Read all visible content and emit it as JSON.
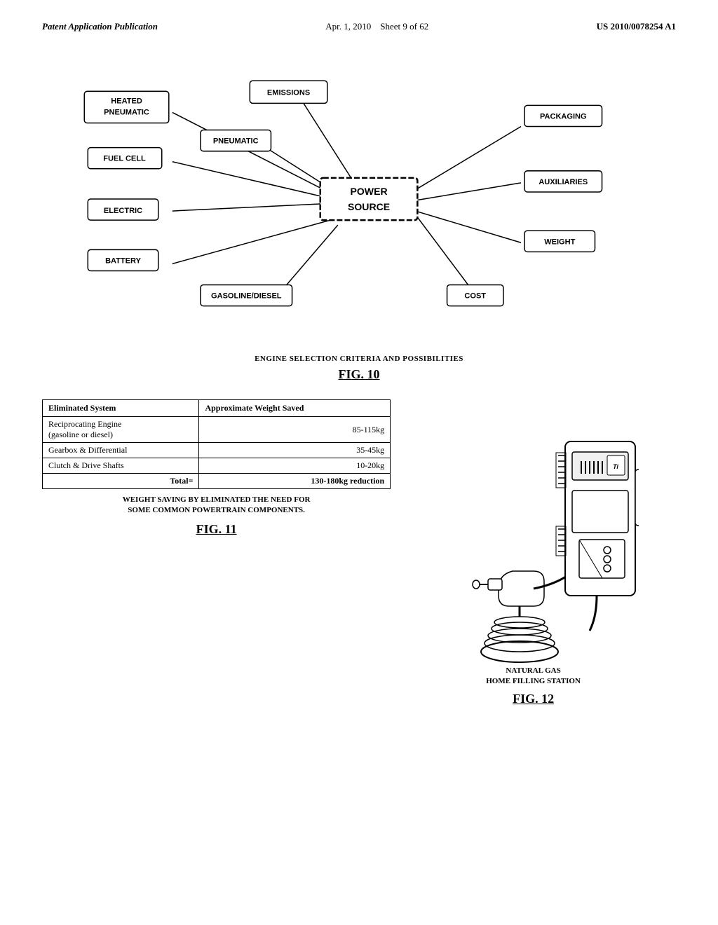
{
  "header": {
    "title": "Patent Application Publication",
    "date": "Apr. 1, 2010",
    "sheet": "Sheet 9 of 62",
    "patent": "US 2010/0078254 A1"
  },
  "fig10": {
    "caption": "ENGINE SELECTION CRITERIA AND POSSIBILITIES",
    "label": "FIG.   10",
    "nodes": {
      "heated_pneumatic": "HEATED\nPNEUMATIC",
      "emissions": "EMISSIONS",
      "pneumatic": "PNEUMATIC",
      "fuel_cell": "FUEL CELL",
      "packaging": "PACKAGING",
      "electric": "ELECTRIC",
      "power_source": "POWER\nSOURCE",
      "auxiliaries": "AUXILIARIES",
      "battery": "BATTERY",
      "weight": "WEIGHT",
      "gasoline_diesel": "GASOLINE/DIESEL",
      "cost": "COST"
    }
  },
  "fig11": {
    "caption": "WEIGHT SAVING BY ELIMINATED THE NEED FOR\nSOME COMMON POWERTRAIN COMPONENTS.",
    "label": "FIG.   11",
    "table": {
      "col1_header": "Eliminated System",
      "col2_header": "Approximate Weight Saved",
      "rows": [
        {
          "system": "Reciprocating Engine\n(gasoline or diesel)",
          "weight": "85-115kg"
        },
        {
          "system": "Gearbox & Differential",
          "weight": "35-45kg"
        },
        {
          "system": "Clutch & Drive Shafts",
          "weight": "10-20kg"
        }
      ],
      "total_label": "Total=",
      "total_value": "130-180kg reduction"
    }
  },
  "fig12": {
    "caption": "NATURAL GAS\nHOME FILLING STATION",
    "label": "FIG.   12"
  }
}
